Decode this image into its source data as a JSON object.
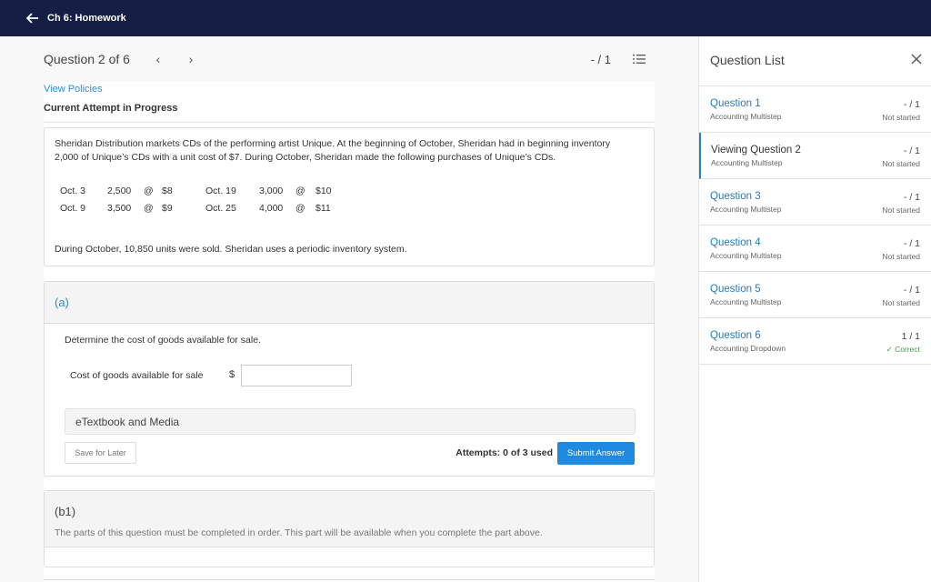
{
  "topbar": {
    "title": "Ch 6: Homework",
    "back_icon": "arrow-left-icon"
  },
  "header": {
    "question_title": "Question 2 of 6",
    "prev": "‹",
    "next": "›",
    "score": "- / 1",
    "list_icon": "question-list-icon"
  },
  "links": {
    "view_policies": "View Policies"
  },
  "status": {
    "current_attempt": "Current Attempt in Progress"
  },
  "problem": {
    "intro": "Sheridan Distribution markets CDs of the performing artist Unique. At the beginning of October, Sheridan had in beginning inventory 2,000 of Unique’s CDs with a unit cost of $7. During October, Sheridan made the following purchases of Unique’s CDs.",
    "purchases": [
      {
        "date": "Oct. 3",
        "qty": "2,500",
        "at": "@",
        "price": "$8",
        "date2": "Oct. 19",
        "qty2": "3,000",
        "at2": "@",
        "price2": "$10"
      },
      {
        "date": "Oct. 9",
        "qty": "3,500",
        "at": "@",
        "price": "$9",
        "date2": "Oct. 25",
        "qty2": "4,000",
        "at2": "@",
        "price2": "$11"
      }
    ],
    "closing": "During October, 10,850 units were sold. Sheridan uses a periodic inventory system."
  },
  "part_a": {
    "label": "(a)",
    "prompt": "Determine the cost of goods available for sale.",
    "field_label": "Cost of goods available for sale",
    "currency": "$",
    "answer_value": "",
    "etextbook": "eTextbook and Media",
    "save_label": "Save for Later",
    "attempts": "Attempts: 0 of 3 used",
    "submit_label": "Submit Answer"
  },
  "part_b1": {
    "label": "(b1)",
    "note": "The parts of this question must be completed in order. This part will be available when you complete the part above."
  },
  "sidebar": {
    "title": "Question List",
    "close_icon": "close-icon",
    "items": [
      {
        "name": "Question 1",
        "type": "Accounting Multistep",
        "points": "- / 1",
        "status": "Not started"
      },
      {
        "name": "Viewing Question 2",
        "type": "Accounting Multistep",
        "points": "- / 1",
        "status": "Not started"
      },
      {
        "name": "Question 3",
        "type": "Accounting Multistep",
        "points": "- / 1",
        "status": "Not started"
      },
      {
        "name": "Question 4",
        "type": "Accounting Multistep",
        "points": "- / 1",
        "status": "Not started"
      },
      {
        "name": "Question 5",
        "type": "Accounting Multistep",
        "points": "- / 1",
        "status": "Not started"
      },
      {
        "name": "Question 6",
        "type": "Accounting Dropdown",
        "points": "1 / 1",
        "status": "✓ Correct"
      }
    ]
  },
  "colors": {
    "topbar": "#151f45",
    "accent": "#1f8ae0",
    "link": "#2a8dd4",
    "correct": "#4a9a4a"
  }
}
